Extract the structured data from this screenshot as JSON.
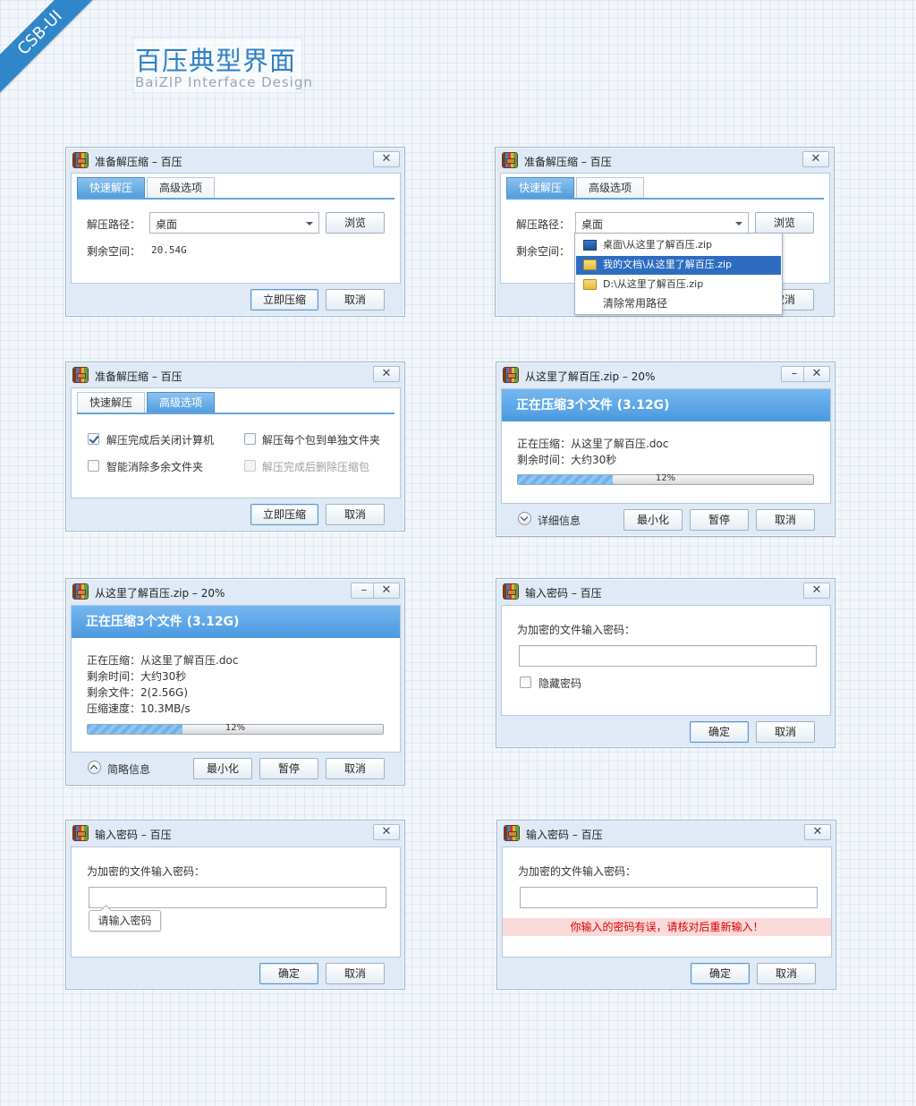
{
  "ribbon": "CSB-UI",
  "page_title": "百压典型界面",
  "page_subtitle": "BaiZIP Interface Design",
  "common": {
    "app_title": "准备解压缩 – 百压",
    "tab_quick": "快速解压",
    "tab_advanced": "高级选项",
    "path_label": "解压路径：",
    "path_value": "桌面",
    "browse": "浏览",
    "space_label": "剩余空间：",
    "space_value": "20.54G",
    "extract_now": "立即压缩",
    "cancel": "取消",
    "ok": "确定",
    "progress_title": "从这里了解百压.zip – 20%",
    "progress_banner": "正在压缩3个文件 (3.12G)",
    "compressing_label": "正在压缩：从这里了解百压.doc",
    "remaining_time": "剩余时间：大约30秒",
    "remaining_files": "剩余文件：2(2.56G)",
    "speed": "压缩速度：10.3MB/s",
    "progress_pct": "12%",
    "progress_value": 0.32,
    "detail_info": "详细信息",
    "brief_info": "简略信息",
    "minimize": "最小化",
    "pause": "暂停",
    "password_title": "输入密码 – 百压",
    "password_prompt": "为加密的文件输入密码：",
    "hide_password": "隐藏密码",
    "password_placeholder_tip": "请输入密码",
    "password_error": "你输入的密码有误，请核对后重新输入！",
    "close_glyph": "✕",
    "min_glyph": "–"
  },
  "dropdown": {
    "items": [
      {
        "label": "桌面\\从这里了解百压.zip",
        "icon": "monitor-icon"
      },
      {
        "label": "我的文档\\从这里了解百压.zip",
        "icon": "folder-icon"
      },
      {
        "label": "D:\\从这里了解百压.zip",
        "icon": "folder-icon"
      },
      {
        "label": "清除常用路径",
        "icon": ""
      }
    ]
  },
  "advanced": {
    "opt1": "解压完成后关闭计算机",
    "opt2": "解压每个包到单独文件夹",
    "opt3": "智能消除多余文件夹",
    "opt4": "解压完成后删除压缩包"
  },
  "colors": {
    "accent": "#4a99df",
    "error_bg": "#fbdada",
    "error_text": "#dd0000"
  }
}
